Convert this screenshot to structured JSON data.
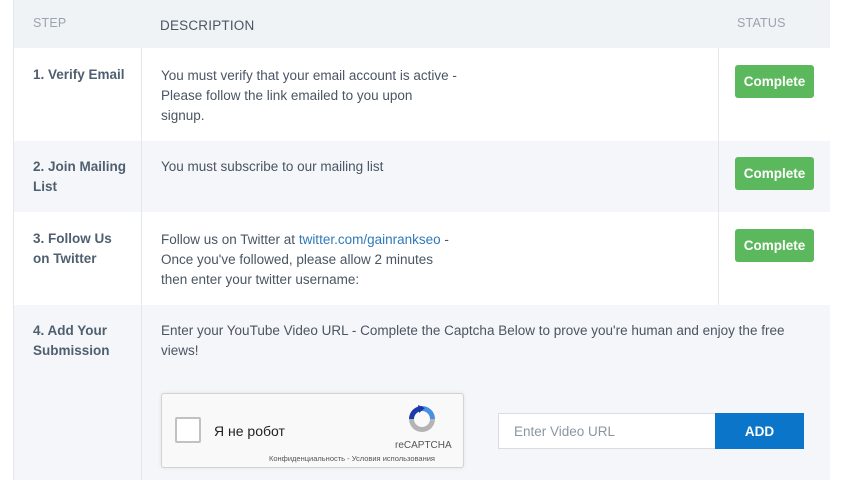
{
  "table": {
    "headers": {
      "step": "STEP",
      "description": "DESCRIPTION",
      "status": "STATUS"
    },
    "rows": [
      {
        "step_line1": "1. Verify Email",
        "step_line2": "",
        "desc_lines": [
          "You must verify that your email account is active -",
          "Please follow the link emailed to you upon",
          "signup."
        ],
        "status": "Complete"
      },
      {
        "step_line1": "2. Join Mailing",
        "step_line2": "List",
        "desc_lines": [
          "You must subscribe to our mailing list"
        ],
        "status": "Complete"
      },
      {
        "step_line1": "3. Follow Us",
        "step_line2": "on Twitter",
        "desc_prefix": "Follow us on Twitter at ",
        "desc_link": "twitter.com/gainrankseo",
        "desc_suffix": " -",
        "desc_lines": [
          "Once you've followed, please allow 2 minutes",
          "then enter your twitter username:"
        ],
        "status": "Complete"
      },
      {
        "step_line1": "4. Add Your",
        "step_line2": "Submission",
        "desc_lines": [
          "Enter your YouTube Video URL - Complete the Captcha Below to prove you're human and enjoy the free",
          "views!"
        ]
      }
    ]
  },
  "captcha": {
    "label": "Я не робот",
    "brand": "reCAPTCHA",
    "terms": "Конфиденциальность - Условия использования",
    "icon": "recaptcha-logo-icon"
  },
  "video_form": {
    "placeholder": "Enter Video URL",
    "value": "",
    "add_label": "ADD"
  },
  "colors": {
    "complete": "#5cb85c",
    "add_button": "#0a75c9",
    "link": "#2f79b8"
  }
}
